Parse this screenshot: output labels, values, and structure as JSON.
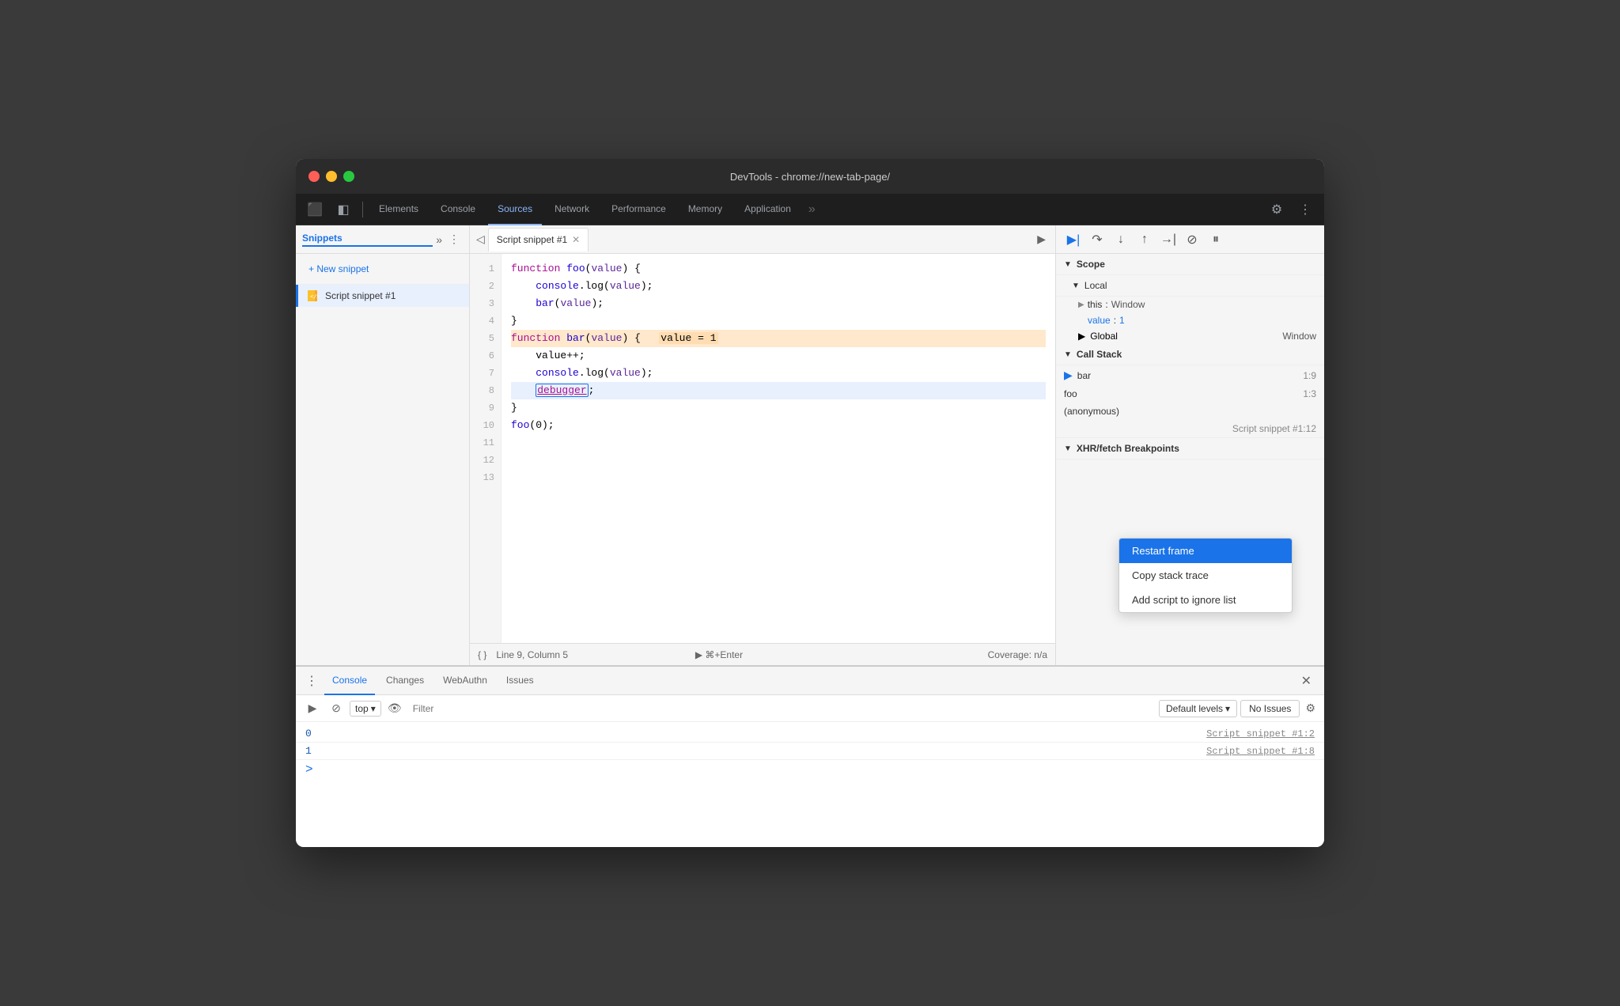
{
  "window": {
    "title": "DevTools - chrome://new-tab-page/"
  },
  "traffic_lights": {
    "close_label": "close",
    "minimize_label": "minimize",
    "maximize_label": "maximize"
  },
  "nav_tabs": [
    {
      "id": "elements",
      "label": "Elements",
      "active": false
    },
    {
      "id": "console",
      "label": "Console",
      "active": false
    },
    {
      "id": "sources",
      "label": "Sources",
      "active": true
    },
    {
      "id": "network",
      "label": "Network",
      "active": false
    },
    {
      "id": "performance",
      "label": "Performance",
      "active": false
    },
    {
      "id": "memory",
      "label": "Memory",
      "active": false
    },
    {
      "id": "application",
      "label": "Application",
      "active": false
    }
  ],
  "sidebar": {
    "title": "Snippets",
    "new_snippet_label": "+ New snippet",
    "snippets": [
      {
        "id": "snippet1",
        "name": "Script snippet #1",
        "active": true
      }
    ]
  },
  "editor": {
    "tab_name": "Script snippet #1",
    "lines": [
      {
        "num": 1,
        "text": "function foo(value) {"
      },
      {
        "num": 2,
        "text": "    console.log(value);"
      },
      {
        "num": 3,
        "text": "    bar(value);"
      },
      {
        "num": 4,
        "text": "}"
      },
      {
        "num": 5,
        "text": ""
      },
      {
        "num": 6,
        "text": "function bar(value) {    value = 1",
        "highlighted": true
      },
      {
        "num": 7,
        "text": "    value++;"
      },
      {
        "num": 8,
        "text": "    console.log(value);"
      },
      {
        "num": 9,
        "text": "    debugger;",
        "active": true
      },
      {
        "num": 10,
        "text": "}"
      },
      {
        "num": 11,
        "text": ""
      },
      {
        "num": 12,
        "text": "foo(0);"
      },
      {
        "num": 13,
        "text": ""
      }
    ]
  },
  "status_bar": {
    "cursor_format_label": "{}",
    "cursor_position": "Line 9, Column 5",
    "run_label": "▶ ⌘+Enter",
    "coverage_label": "Coverage: n/a"
  },
  "debugger": {
    "scope_label": "Scope",
    "local_label": "Local",
    "this_label": "this",
    "this_value": "Window",
    "value_label": "value",
    "value_val": "1",
    "global_label": "Global",
    "global_value": "Window",
    "callstack_label": "Call Stack",
    "callstack_items": [
      {
        "name": "bar",
        "loc": "1:9"
      },
      {
        "name": "foo",
        "loc": "1:3"
      },
      {
        "name": "(anonymous)",
        "loc": ""
      }
    ],
    "callstack_source": "Script snippet #1:12",
    "xhr_label": "XHR/fetch Breakpoints"
  },
  "context_menu": {
    "items": [
      {
        "id": "restart-frame",
        "label": "Restart frame",
        "active": true
      },
      {
        "id": "copy-stack-trace",
        "label": "Copy stack trace",
        "active": false
      },
      {
        "id": "add-to-ignore",
        "label": "Add script to ignore list",
        "active": false
      }
    ]
  },
  "bottom_panel": {
    "tabs": [
      {
        "id": "console",
        "label": "Console",
        "active": true
      },
      {
        "id": "changes",
        "label": "Changes",
        "active": false
      },
      {
        "id": "webauthn",
        "label": "WebAuthn",
        "active": false
      },
      {
        "id": "issues",
        "label": "Issues",
        "active": false
      }
    ],
    "top_label": "top",
    "filter_placeholder": "Filter",
    "default_levels_label": "Default levels",
    "no_issues_label": "No Issues",
    "console_rows": [
      {
        "value": "0",
        "source": "Script snippet #1:2"
      },
      {
        "value": "1",
        "source": "Script snippet #1:8"
      }
    ]
  }
}
